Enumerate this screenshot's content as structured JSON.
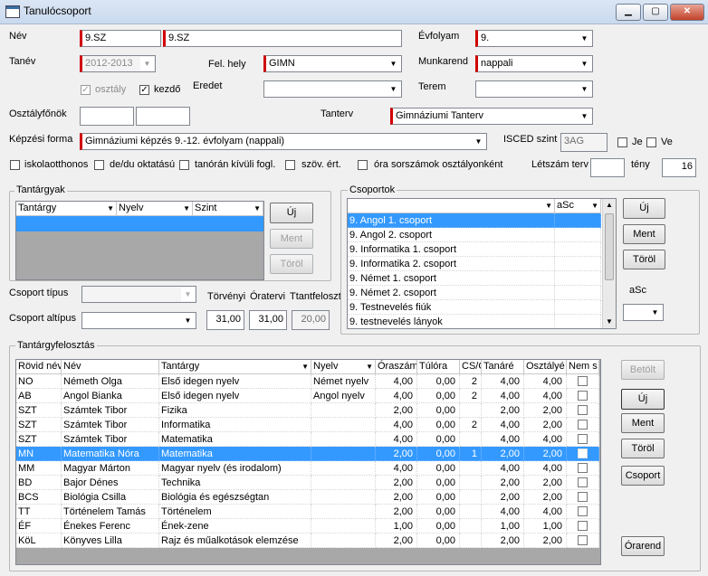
{
  "window": {
    "title": "Tanulócsoport",
    "minimize": "▁",
    "maximize": "▢",
    "close": "✕"
  },
  "form": {
    "nev_label": "Név",
    "nev1": "9.SZ",
    "nev2": "9.SZ",
    "evfolyam_label": "Évfolyam",
    "evfolyam": "9.",
    "tanev_label": "Tanév",
    "tanev": "2012-2013",
    "felhely_label": "Fel. hely",
    "felhely": "GIMN",
    "munkarend_label": "Munkarend",
    "munkarend": "nappali",
    "osztaly_label": "osztály",
    "kezdo_label": "kezdő",
    "eredet_label": "Eredet",
    "eredet": "",
    "terem_label": "Terem",
    "terem": "",
    "osztalyfonok_label": "Osztályfőnök",
    "ofo1": "",
    "ofo2": "",
    "tanterv_label": "Tanterv",
    "tanterv": "Gimnáziumi Tanterv",
    "kepzesi_label": "Képzési forma",
    "kepzesi": "Gimnáziumi képzés 9.-12. évfolyam (nappali)",
    "isced_label": "ISCED szint",
    "isced": "3AG",
    "je_label": "Je",
    "ve_label": "Ve",
    "iskolaotthonos": "iskolaotthonos",
    "dedu": "de/du oktatású",
    "tanoran": "tanórán kívüli fogl.",
    "szov": "szöv. ért.",
    "ora_sorszam": "óra sorszámok osztályonként",
    "letszam_label": "Létszám terv",
    "letszam": "",
    "teny_label": "tény",
    "teny": "16",
    "csoport_tipus_label": "Csoport típus",
    "csoport_tipus": "",
    "csoport_altipus_label": "Csoport altípus",
    "csoport_altipus": "",
    "torvenyi_label": "Törvényi",
    "oratervi_label": "Óratervi",
    "ttantfeloszt_label": "Ttantfeloszt",
    "torvenyi": "31,00",
    "oratervi": "31,00",
    "ttantfeloszt": "20,00"
  },
  "tantargyak": {
    "title": "Tantárgyak",
    "headers": [
      "Tantárgy",
      "Nyelv",
      "Szint"
    ],
    "buttons": {
      "uj": "Új",
      "ment": "Ment",
      "torol": "Töröl"
    }
  },
  "csoportok": {
    "title": "Csoportok",
    "headers": [
      "",
      "aSc"
    ],
    "rows": [
      "9. Angol 1. csoport",
      "9. Angol 2. csoport",
      "9. Informatika 1. csoport",
      "9. Informatika 2. csoport",
      "9. Német 1. csoport",
      "9. Német 2. csoport",
      "9. Testnevelés fiúk",
      "9. testnevelés lányok"
    ],
    "buttons": {
      "uj": "Új",
      "ment": "Ment",
      "torol": "Töröl"
    },
    "asc_label": "aSc",
    "asc_value": ""
  },
  "felosztas": {
    "title": "Tantárgyfelosztás",
    "headers": [
      "Rövid név",
      "Név",
      "Tantárgy",
      "Nyelv",
      "Óraszám",
      "Túlóra",
      "CS/O",
      "Tanáré",
      "Osztályé",
      "Nem s"
    ],
    "rows": [
      [
        "NO",
        "Németh Olga",
        "Első idegen nyelv",
        "Német nyelv",
        "4,00",
        "0,00",
        "2",
        "4,00",
        "4,00"
      ],
      [
        "AB",
        "Angol Bianka",
        "Első idegen nyelv",
        "Angol nyelv",
        "4,00",
        "0,00",
        "2",
        "4,00",
        "4,00"
      ],
      [
        "SZT",
        "Számtek Tibor",
        "Fizika",
        "",
        "2,00",
        "0,00",
        "",
        "2,00",
        "2,00"
      ],
      [
        "SZT",
        "Számtek Tibor",
        "Informatika",
        "",
        "4,00",
        "0,00",
        "2",
        "4,00",
        "2,00"
      ],
      [
        "SZT",
        "Számtek Tibor",
        "Matematika",
        "",
        "4,00",
        "0,00",
        "",
        "4,00",
        "4,00"
      ],
      [
        "MN",
        "Matematika Nóra",
        "Matematika",
        "",
        "2,00",
        "0,00",
        "1",
        "2,00",
        "2,00"
      ],
      [
        "MM",
        "Magyar Márton",
        "Magyar nyelv (és irodalom)",
        "",
        "4,00",
        "0,00",
        "",
        "4,00",
        "4,00"
      ],
      [
        "BD",
        "Bajor Dénes",
        "Technika",
        "",
        "2,00",
        "0,00",
        "",
        "2,00",
        "2,00"
      ],
      [
        "BCS",
        "Biológia Csilla",
        "Biológia és egészségtan",
        "",
        "2,00",
        "0,00",
        "",
        "2,00",
        "2,00"
      ],
      [
        "TT",
        "Történelem Tamás",
        "Történelem",
        "",
        "2,00",
        "0,00",
        "",
        "4,00",
        "4,00"
      ],
      [
        "ÉF",
        "Énekes Ferenc",
        "Ének-zene",
        "",
        "1,00",
        "0,00",
        "",
        "1,00",
        "1,00"
      ],
      [
        "KöL",
        "Könyves Lilla",
        "Rajz és műalkotások elemzése",
        "",
        "2,00",
        "0,00",
        "",
        "2,00",
        "2,00"
      ]
    ],
    "selected_row": 5,
    "buttons": {
      "betolt": "Betölt",
      "uj": "Új",
      "ment": "Ment",
      "torol": "Töröl",
      "csoport": "Csoport",
      "orarend": "Órarend"
    }
  }
}
